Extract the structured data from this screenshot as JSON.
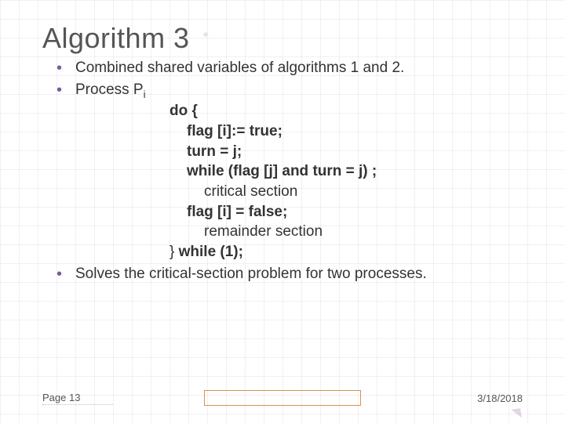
{
  "title": "Algorithm 3",
  "bullets": {
    "b1": "Combined shared variables of algorithms 1 and 2.",
    "b2_prefix": "Process P",
    "b2_sub": "i",
    "b3": "Solves the critical-section problem for two processes."
  },
  "code": {
    "l1": "do {",
    "l2": "flag [i]:= true;",
    "l3": "turn = j;",
    "l4": "while (flag [j] and turn = j) ;",
    "l5": "critical section",
    "l6": "flag [i] = false;",
    "l7": "remainder section",
    "l8a": "} ",
    "l8b": "while (1);"
  },
  "footer": {
    "page": "Page 13",
    "date": "3/18/2018"
  }
}
